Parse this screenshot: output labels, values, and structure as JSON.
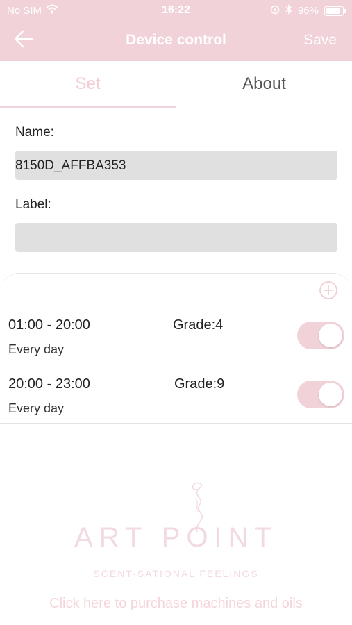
{
  "status_bar": {
    "carrier": "No SIM",
    "time": "16:22",
    "battery": "96%"
  },
  "navbar": {
    "title": "Device control",
    "save_label": "Save"
  },
  "tabs": [
    {
      "label": "Set",
      "active": true
    },
    {
      "label": "About",
      "active": false
    }
  ],
  "form": {
    "name_label": "Name:",
    "name_value": "8150D_AFFBA353",
    "label_label": "Label:",
    "label_value": ""
  },
  "schedules": [
    {
      "time_range": "01:00 - 20:00",
      "grade": "Grade:4",
      "repeat": "Every day",
      "enabled": true
    },
    {
      "time_range": "20:00 - 23:00",
      "grade": "Grade:9",
      "repeat": "Every day",
      "enabled": true
    }
  ],
  "brand": {
    "name": "ART POINT",
    "tagline": "SCENT-SATIONAL FEELINGS",
    "purchase_link": "Click here to purchase machines and oils"
  },
  "colors": {
    "accent": "#f0d2d8",
    "faint_accent": "#f2dbe0"
  }
}
